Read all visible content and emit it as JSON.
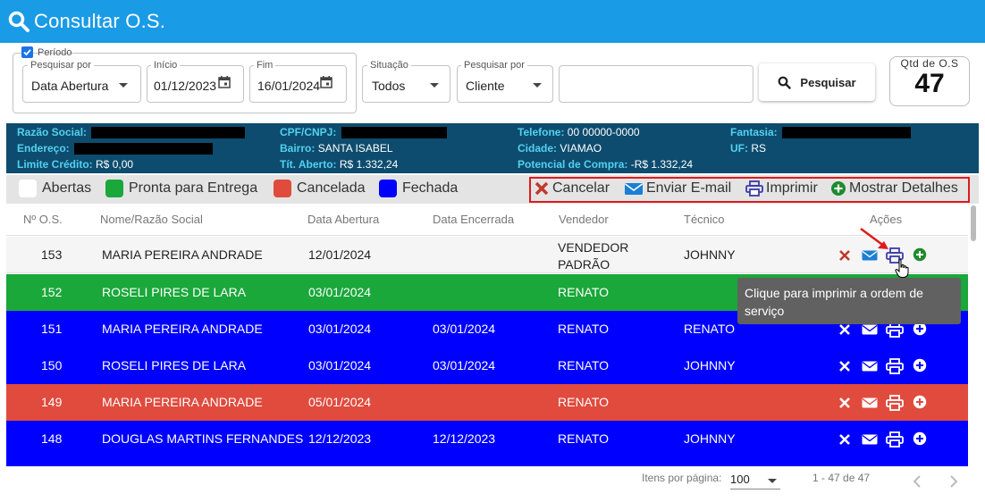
{
  "header": {
    "title": "Consultar O.S."
  },
  "filters": {
    "periodo_label": "Período",
    "pesquisar_por_label": "Pesquisar por",
    "pesquisar_por_value": "Data Abertura",
    "inicio_label": "Início",
    "inicio_value": "01/12/2023",
    "fim_label": "Fim",
    "fim_value": "16/01/2024",
    "situacao_label": "Situação",
    "situacao_value": "Todos",
    "pesquisar_por2_label": "Pesquisar por",
    "pesquisar_por2_value": "Cliente",
    "search_text": "",
    "search_button": "Pesquisar"
  },
  "qtd": {
    "label": "Qtd de O.S",
    "value": "47"
  },
  "client": {
    "razao_label": "Razão Social:",
    "endereco_label": "Endereço:",
    "limite_label": "Limite Crédito:",
    "limite_value": "R$ 0,00",
    "cpf_label": "CPF/CNPJ:",
    "bairro_label": "Bairro:",
    "bairro_value": "SANTA ISABEL",
    "tit_label": "Tít. Aberto:",
    "tit_value": "R$ 1.332,24",
    "telefone_label": "Telefone:",
    "telefone_value": "00 00000-0000",
    "cidade_label": "Cidade:",
    "cidade_value": "VIAMAO",
    "potencial_label": "Potencial de Compra:",
    "potencial_value": "-R$ 1.332,24",
    "fantasia_label": "Fantasia:",
    "uf_label": "UF:",
    "uf_value": "RS"
  },
  "legend": {
    "abertas": "Abertas",
    "pronta": "Pronta para Entrega",
    "cancelada": "Cancelada",
    "fechada": "Fechada",
    "colors": {
      "abertas": "#ffffff",
      "pronta": "#1aa83a",
      "cancelada": "#e04b3e",
      "fechada": "#0000ff"
    }
  },
  "actions": {
    "cancelar": "Cancelar",
    "email": "Enviar E-mail",
    "imprimir": "Imprimir",
    "detalhes": "Mostrar Detalhes"
  },
  "table": {
    "columns": [
      "Nº O.S.",
      "Nome/Razão Social",
      "Data Abertura",
      "Data Encerrada",
      "Vendedor",
      "Técnico",
      "Ações"
    ],
    "rows": [
      {
        "os": "153",
        "nome": "MARIA PEREIRA ANDRADE",
        "abertura": "12/01/2024",
        "encerrada": "",
        "vendedor_1": "VENDEDOR",
        "vendedor_2": "PADRÃO",
        "tecnico": "JOHNNY",
        "status": "aberta"
      },
      {
        "os": "152",
        "nome": "ROSELI PIRES DE LARA",
        "abertura": "03/01/2024",
        "encerrada": "",
        "vendedor": "RENATO",
        "tecnico": "",
        "status": "pronta"
      },
      {
        "os": "151",
        "nome": "MARIA PEREIRA ANDRADE",
        "abertura": "03/01/2024",
        "encerrada": "03/01/2024",
        "vendedor": "RENATO",
        "tecnico": "RENATO",
        "status": "fechada"
      },
      {
        "os": "150",
        "nome": "ROSELI PIRES DE LARA",
        "abertura": "03/01/2024",
        "encerrada": "03/01/2024",
        "vendedor": "RENATO",
        "tecnico": "JOHNNY",
        "status": "fechada"
      },
      {
        "os": "149",
        "nome": "MARIA PEREIRA ANDRADE",
        "abertura": "05/01/2024",
        "encerrada": "",
        "vendedor": "RENATO",
        "tecnico": "",
        "status": "cancelada"
      },
      {
        "os": "148",
        "nome": "DOUGLAS MARTINS FERNANDES",
        "abertura": "12/12/2023",
        "encerrada": "12/12/2023",
        "vendedor": "RENATO",
        "tecnico": "JOHNNY",
        "status": "fechada"
      }
    ]
  },
  "tooltip": {
    "text": "Clique para imprimir a ordem de serviço"
  },
  "paginator": {
    "items_label": "Itens por página:",
    "page_size": "100",
    "range": "1 - 47 de 47"
  },
  "icons": [
    "search-icon",
    "calendar-icon",
    "close-icon",
    "email-icon",
    "print-icon",
    "plus-circle-icon",
    "chevron-left-icon",
    "chevron-right-icon",
    "cursor-hand-icon",
    "arrow-annotation-icon"
  ]
}
